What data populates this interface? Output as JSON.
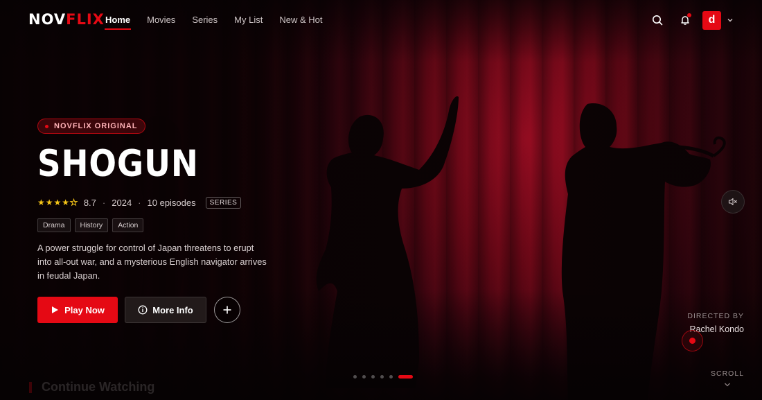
{
  "brand": {
    "logo_part1": "NOV",
    "logo_part2": "FLIX",
    "accent_color": "#e50914"
  },
  "nav": {
    "links": [
      {
        "label": "Home",
        "active": true
      },
      {
        "label": "Movies",
        "active": false
      },
      {
        "label": "Series",
        "active": false
      },
      {
        "label": "My List",
        "active": false
      },
      {
        "label": "New & Hot",
        "active": false
      }
    ],
    "icons": [
      "search-icon",
      "bell-icon"
    ],
    "notification_dot": true,
    "avatar_letter": "d"
  },
  "hero": {
    "badge": "NOVFLIX ORIGINAL",
    "title": "SHOGUN",
    "rating_stars": 4,
    "rating_max_stars": 5,
    "rating": "8.7",
    "year": "2024",
    "episodes": "10 episodes",
    "type": "SERIES",
    "genres": [
      "Drama",
      "History",
      "Action"
    ],
    "description": "A power struggle for control of Japan threatens to erupt into all-out war, and a mysterious English navigator arrives in feudal Japan.",
    "play_label": "Play Now",
    "info_label": "More Info",
    "director_label": "DIRECTED BY",
    "director_name": "Rachel Kondo",
    "scroll_label": "SCROLL"
  },
  "carousel": {
    "total_slides": 6,
    "active_index": 5
  },
  "rows": {
    "continue_watching_title": "Continue Watching"
  }
}
